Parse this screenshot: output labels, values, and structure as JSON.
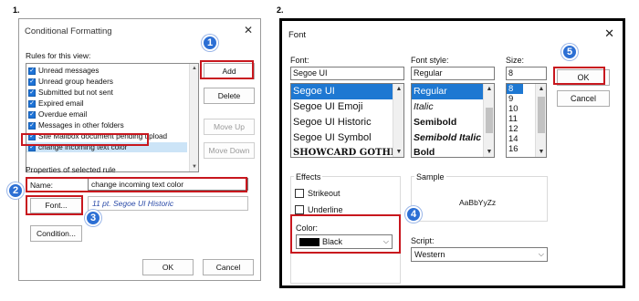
{
  "step_labels": {
    "left": "1.",
    "right": "2."
  },
  "badges": {
    "b1": "1",
    "b2": "2",
    "b3": "3",
    "b4": "4",
    "b5": "5"
  },
  "colors": {
    "annotation_red": "#c8171e",
    "badge_blue": "#2c6fd4",
    "selection_blue": "#1e78d2"
  },
  "cond_formatting": {
    "title": "Conditional Formatting",
    "close_glyph": "✕",
    "rules_label": "Rules for this view:",
    "rules": [
      "Unread messages",
      "Unread group headers",
      "Submitted but not sent",
      "Expired email",
      "Overdue email",
      "Messages in other folders",
      "Site Mailbox document pending upload",
      "change incoming text color"
    ],
    "buttons": {
      "add": "Add",
      "delete": "Delete",
      "move_up": "Move Up",
      "move_down": "Move Down",
      "font": "Font...",
      "condition": "Condition...",
      "ok": "OK",
      "cancel": "Cancel"
    },
    "properties_label": "Properties of selected rule",
    "name_label": "Name:",
    "name_value": "change incoming text color",
    "font_description": "11 pt. Segoe UI Historic"
  },
  "font_dialog": {
    "title": "Font",
    "close_glyph": "✕",
    "font_label": "Font:",
    "font_value": "Segoe UI",
    "fonts": [
      "Segoe UI",
      "Segoe UI Emoji",
      "Segoe UI Historic",
      "Segoe UI Symbol",
      "SHOWCARD GOTHI"
    ],
    "style_label": "Font style:",
    "style_value": "Regular",
    "styles": [
      "Regular",
      "Italic",
      "Semibold",
      "Semibold Italic",
      "Bold"
    ],
    "size_label": "Size:",
    "size_value": "8",
    "sizes": [
      "8",
      "9",
      "10",
      "11",
      "12",
      "14",
      "16"
    ],
    "ok": "OK",
    "cancel": "Cancel",
    "effects_label": "Effects",
    "strikeout_label": "Strikeout",
    "underline_label": "Underline",
    "color_label": "Color:",
    "color_value": "Black",
    "color_swatch": "#000000",
    "sample_label": "Sample",
    "sample_text": "AaBbYyZz",
    "script_label": "Script:",
    "script_value": "Western"
  }
}
